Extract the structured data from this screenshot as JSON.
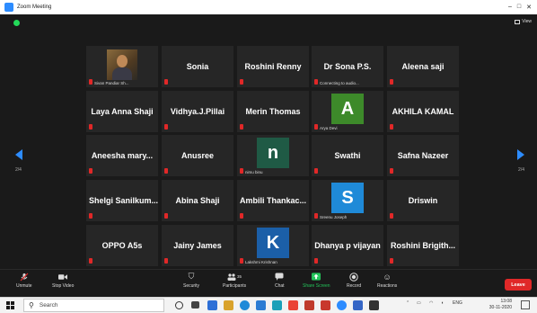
{
  "window": {
    "title": "Zoom Meeting"
  },
  "view_label": "View",
  "pages": {
    "left": "2/4",
    "right": "2/4"
  },
  "grid": [
    [
      {
        "name": "",
        "sub": "Sivan Pandiar Sh...",
        "type": "photo"
      },
      {
        "name": "Sonia",
        "sub": "",
        "type": "name"
      },
      {
        "name": "Roshini Renny",
        "sub": "",
        "type": "name"
      },
      {
        "name": "Dr Sona P.S.",
        "sub": "Connecting to audio...",
        "type": "name"
      },
      {
        "name": "Aleena saji",
        "sub": "",
        "type": "name"
      }
    ],
    [
      {
        "name": "Laya Anna Shaji",
        "sub": "",
        "type": "name"
      },
      {
        "name": "Vidhya.J.Pillai",
        "sub": "",
        "type": "name"
      },
      {
        "name": "Merin Thomas",
        "sub": "",
        "type": "name"
      },
      {
        "name": "A",
        "sub": "Arya Devi",
        "type": "avatar",
        "color": "#3d8a2a"
      },
      {
        "name": "AKHILA KAMAL",
        "sub": "",
        "type": "name"
      }
    ],
    [
      {
        "name": "Aneesha mary...",
        "sub": "",
        "type": "name"
      },
      {
        "name": "Anusree",
        "sub": "",
        "type": "name"
      },
      {
        "name": "n",
        "sub": "nimu binu",
        "type": "avatar",
        "color": "#1f5a45"
      },
      {
        "name": "Swathi",
        "sub": "",
        "type": "name"
      },
      {
        "name": "Safna Nazeer",
        "sub": "",
        "type": "name"
      }
    ],
    [
      {
        "name": "Shelgi Sanilkum...",
        "sub": "",
        "type": "name"
      },
      {
        "name": "Abina Shaji",
        "sub": "",
        "type": "name"
      },
      {
        "name": "Ambili Thankac...",
        "sub": "",
        "type": "name"
      },
      {
        "name": "S",
        "sub": "Sreenu Joseph",
        "type": "avatar",
        "color": "#1f8ad8"
      },
      {
        "name": "Driswin",
        "sub": "",
        "type": "name"
      }
    ],
    [
      {
        "name": "OPPO A5s",
        "sub": "",
        "type": "name"
      },
      {
        "name": "Jainy James",
        "sub": "",
        "type": "name"
      },
      {
        "name": "K",
        "sub": "Lakshmi Krishnan",
        "type": "avatar",
        "color": "#1b5fa8"
      },
      {
        "name": "Dhanya p vijayan",
        "sub": "",
        "type": "name"
      },
      {
        "name": "Roshini Brigith...",
        "sub": "",
        "type": "name"
      }
    ]
  ],
  "toolbar": {
    "unmute": "Unmute",
    "stop_video": "Stop Video",
    "security": "Security",
    "participants": "Participants",
    "participants_count": "35",
    "chat": "Chat",
    "share_screen": "Share Screen",
    "record": "Record",
    "reactions": "Reactions",
    "leave": "Leave",
    "share_color": "#23c45a",
    "leave_color": "#e02828"
  },
  "taskbar": {
    "search_placeholder": "Search",
    "time": "13:08",
    "date": "30-11-2020",
    "lang": "ENG"
  }
}
